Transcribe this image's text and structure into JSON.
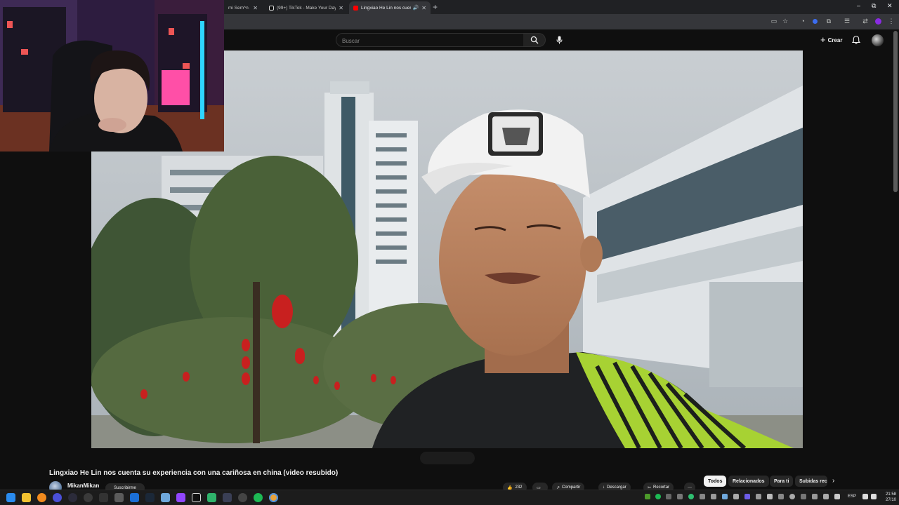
{
  "browser": {
    "tabs": [
      {
        "title": "mi Sem^n Sto",
        "active": false
      },
      {
        "title": "(99+) TikTok - Make Your Day",
        "active": false
      },
      {
        "title": "Lingxiao He Lin nos cuenta",
        "active": true
      }
    ],
    "new_tab": "+",
    "window_controls": {
      "minimize": "–",
      "maximize": "⧉",
      "close": "✕"
    }
  },
  "masthead": {
    "search_placeholder": "Buscar",
    "create_label": "Crear"
  },
  "video": {
    "title": "Lingxiao He Lin nos cuenta su experiencia con una cariñosa en china (video resubido)",
    "channel": "MikanMikan",
    "subscribe_label": "Suscribirme",
    "like_count": "232",
    "share_label": "Compartir",
    "download_label": "Descargar",
    "clip_label": "Recortar"
  },
  "chips": {
    "items": [
      {
        "label": "Todos",
        "active": true
      },
      {
        "label": "Relacionados",
        "active": false
      },
      {
        "label": "Para ti",
        "active": false
      },
      {
        "label": "Subidas rec",
        "active": false
      }
    ]
  },
  "taskbar": {
    "language": "ESP",
    "time": "21:58",
    "date": "27/10"
  },
  "colors": {
    "background": "#0f0f0f",
    "chrome_dark": "#202124",
    "chrome_toolbar": "#35363a",
    "youtube_red": "#ff0000",
    "chip_active": "#f1f1f1"
  }
}
